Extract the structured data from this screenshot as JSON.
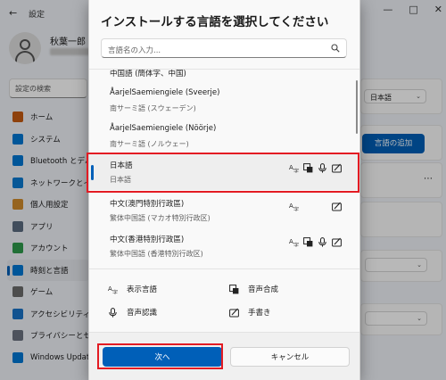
{
  "background": {
    "window_title": "設定",
    "profile": {
      "name": "秋葉一郎"
    },
    "search_placeholder": "設定の検索",
    "nav": [
      {
        "label": "ホーム",
        "icon": "home-icon",
        "color": "#c55a11"
      },
      {
        "label": "システム",
        "icon": "system-icon",
        "color": "#0078d4"
      },
      {
        "label": "Bluetooth とデバイス",
        "icon": "bluetooth-icon",
        "color": "#0078d4"
      },
      {
        "label": "ネットワークとインターネット",
        "icon": "network-icon",
        "color": "#0a7ad1"
      },
      {
        "label": "個人用設定",
        "icon": "brush-icon",
        "color": "#d08b2c"
      },
      {
        "label": "アプリ",
        "icon": "apps-icon",
        "color": "#5b6b80"
      },
      {
        "label": "アカウント",
        "icon": "account-icon",
        "color": "#2e9a4b"
      },
      {
        "label": "時刻と言語",
        "icon": "time-language-icon",
        "color": "#0078d4"
      },
      {
        "label": "ゲーム",
        "icon": "gaming-icon",
        "color": "#6b6b6b"
      },
      {
        "label": "アクセシビリティ",
        "icon": "accessibility-icon",
        "color": "#1a73c8"
      },
      {
        "label": "プライバシーとセキュリティ",
        "icon": "shield-icon",
        "color": "#6b7280"
      },
      {
        "label": "Windows Update",
        "icon": "windows-update-icon",
        "color": "#0078d4"
      }
    ],
    "active_nav_index": 7,
    "right": {
      "display_language": "日本語",
      "add_language_button": "言語の追加"
    }
  },
  "dialog": {
    "title": "インストールする言語を選択してください",
    "search_placeholder": "言語名の入力...",
    "languages": [
      {
        "name": "中国語 (簡体字、中国)",
        "native": "",
        "features": []
      },
      {
        "name": "ÅarjelSaemiengiele (Sveerje)",
        "native": "南サーミ語 (スウェーデン)",
        "features": []
      },
      {
        "name": "ÅarjelSaemiengiele (Nöörje)",
        "native": "南サーミ語 (ノルウェー)",
        "features": []
      },
      {
        "name": "日本語",
        "native": "日本語",
        "features": [
          "display-language-icon",
          "speech-synthesis-icon",
          "microphone-icon",
          "handwriting-icon"
        ],
        "selected": true
      },
      {
        "name": "中文(澳門特別行政區)",
        "native": "繁体中国語 (マカオ特別行政区)",
        "features": [
          "display-language-icon",
          "handwriting-icon"
        ]
      },
      {
        "name": "中文(香港特別行政區)",
        "native": "繁体中国語 (香港特別行政区)",
        "features": [
          "display-language-icon",
          "speech-synthesis-icon",
          "microphone-icon",
          "handwriting-icon"
        ]
      }
    ],
    "legend": {
      "display_language": "表示言語",
      "speech_synthesis": "音声合成",
      "speech_recognition": "音声認識",
      "handwriting": "手書き"
    },
    "next_button": "次へ",
    "cancel_button": "キャンセル"
  },
  "colors": {
    "accent": "#005fb8",
    "highlight": "#e31b23"
  }
}
